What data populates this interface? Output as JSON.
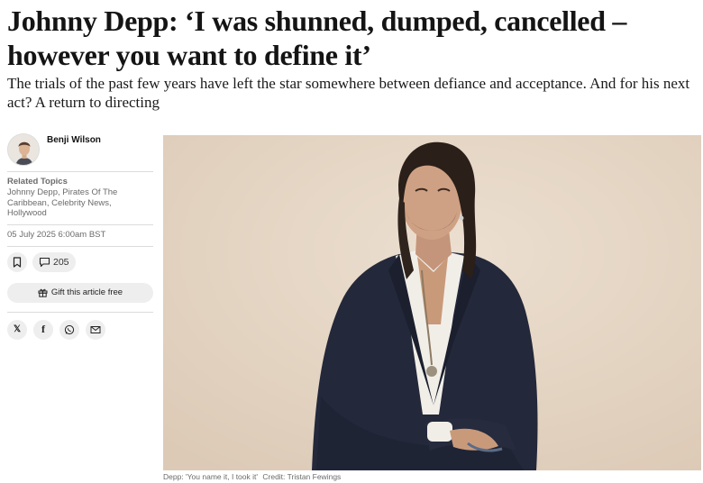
{
  "article": {
    "headline": "Johnny Depp: ‘I was shunned, dumped, cancelled – however you want to define it’",
    "standfirst": "The trials of the past few years have left the star somewhere between defiance and acceptance. And for his next act? A return to directing"
  },
  "sidebar": {
    "author_name": "Benji Wilson",
    "related_topics_label": "Related Topics",
    "related_topics": "Johnny Depp, Pirates Of The Caribbean, Celebrity News, Hollywood",
    "date": "05 July 2025 6:00am BST",
    "comment_count": "205",
    "gift_label": "Gift this article free",
    "share_x": "𝕏",
    "share_facebook": "f"
  },
  "image": {
    "caption": "Depp: 'You name it, I took it'",
    "credit": "Credit: Tristan Fewings"
  },
  "colors": {
    "background": "#ffffff",
    "text": "#121212",
    "muted": "#6b6b6b",
    "button_bg": "#eeeeee",
    "photo_backdrop": "#e6d7c6"
  },
  "icons": [
    "bookmark-icon",
    "comment-icon",
    "gift-icon",
    "x-icon",
    "facebook-icon",
    "whatsapp-icon",
    "email-icon"
  ]
}
